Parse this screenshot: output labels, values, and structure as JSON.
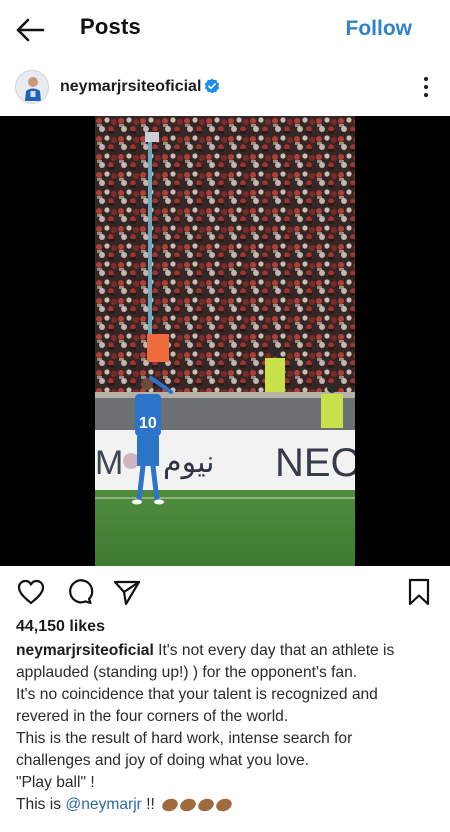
{
  "topbar": {
    "title": "Posts",
    "follow_label": "Follow",
    "back_icon": "arrow-left-icon"
  },
  "post": {
    "username": "neymarjrsiteoficial",
    "verified_icon": "verified-badge-icon",
    "more_icon": "more-vertical-icon",
    "photo": {
      "banner_left": "M",
      "banner_arabic": "نيوم",
      "banner_right": "NEO",
      "jersey_number": "10"
    },
    "actions": {
      "like_icon": "heart-icon",
      "comment_icon": "comment-icon",
      "share_icon": "send-icon",
      "save_icon": "bookmark-icon"
    },
    "likes": "44,150 likes",
    "caption": {
      "username": "neymarjrsiteoficial",
      "line1": " It's not every day that an athlete is",
      "line2": "applauded (standing up!) ) for the opponent's fan.",
      "line3": "It's no coincidence that your talent is recognized and",
      "line4": "revered in the four corners of the world.",
      "line5": "This is the result of hard work, intense search for",
      "line6": "challenges and joy of doing what you love.",
      "line7": "\"Play ball\" !",
      "line8_prefix": "This is ",
      "mention": "@neymarjr",
      "line8_suffix": " !! ",
      "emoji_icon": "clapping-hands-icon"
    }
  },
  "colors": {
    "accent": "#2f84c7",
    "verified": "#1d8ef0",
    "text": "#111111"
  }
}
